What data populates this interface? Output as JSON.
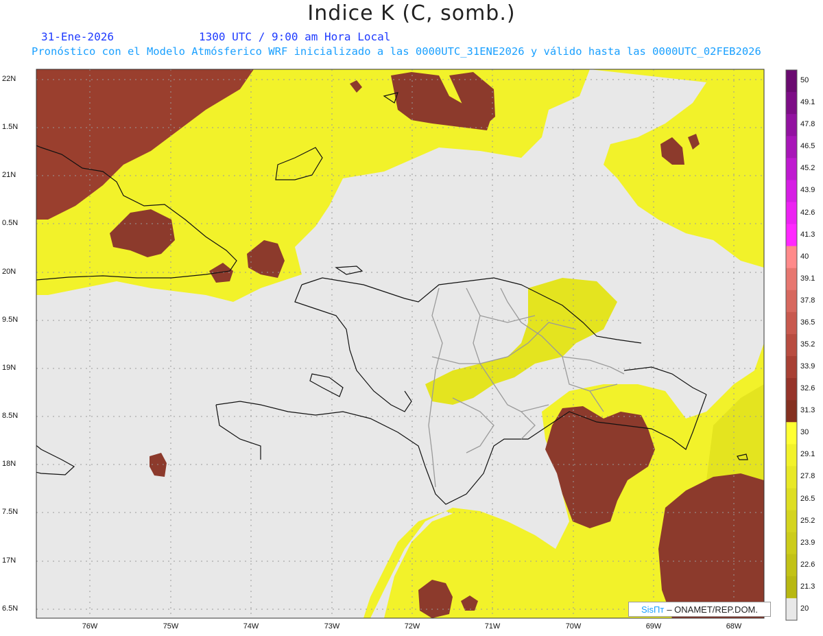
{
  "header": {
    "title": "Indice K (C, somb.)",
    "date": "31-Ene-2026",
    "time": "1300 UTC / 9:00 am Hora Local",
    "forecast": "Pronóstico con el Modelo Atmósferico WRF inicializado a las 0000UTC_31ENE2026 y válido hasta las  0000UTC_02FEB2026"
  },
  "axes": {
    "lat_labels": [
      "22N",
      "1.5N",
      "21N",
      "0.5N",
      "20N",
      "9.5N",
      "19N",
      "8.5N",
      "18N",
      "7.5N",
      "17N",
      "6.5N"
    ],
    "lon_labels": [
      "76W",
      "75W",
      "74W",
      "73W",
      "72W",
      "71W",
      "70W",
      "69W",
      "68W"
    ]
  },
  "colorbar": {
    "labels": [
      "50",
      "49.1",
      "47.8",
      "46.5",
      "45.2",
      "43.9",
      "42.6",
      "41.3",
      "40",
      "39.1",
      "37.8",
      "36.5",
      "35.2",
      "33.9",
      "32.6",
      "31.3",
      "30",
      "29.1",
      "27.8",
      "26.5",
      "25.2",
      "23.9",
      "22.6",
      "21.3",
      "20"
    ],
    "colors": [
      "#6a0a70",
      "#7d0d86",
      "#9212a0",
      "#a816b8",
      "#bf1ad0",
      "#d61ee4",
      "#ec22f2",
      "#ff28ff",
      "#ff8a8a",
      "#e77770",
      "#d7685e",
      "#c8594e",
      "#b84c40",
      "#a84034",
      "#96342a",
      "#843020",
      "#ffff33",
      "#f2f22a",
      "#e8e826",
      "#dede22",
      "#d4d41e",
      "#cccc1a",
      "#c2c216",
      "#b8b812",
      "#e8e8e8"
    ]
  },
  "legend_colors": {
    "no_data": "#e8e8e8",
    "k_20_30": "#f0f026",
    "k_30_40": "#8c3a2c"
  },
  "credit": {
    "brand": "SisПт",
    "text": "– ONAMET/REP.DOM."
  }
}
